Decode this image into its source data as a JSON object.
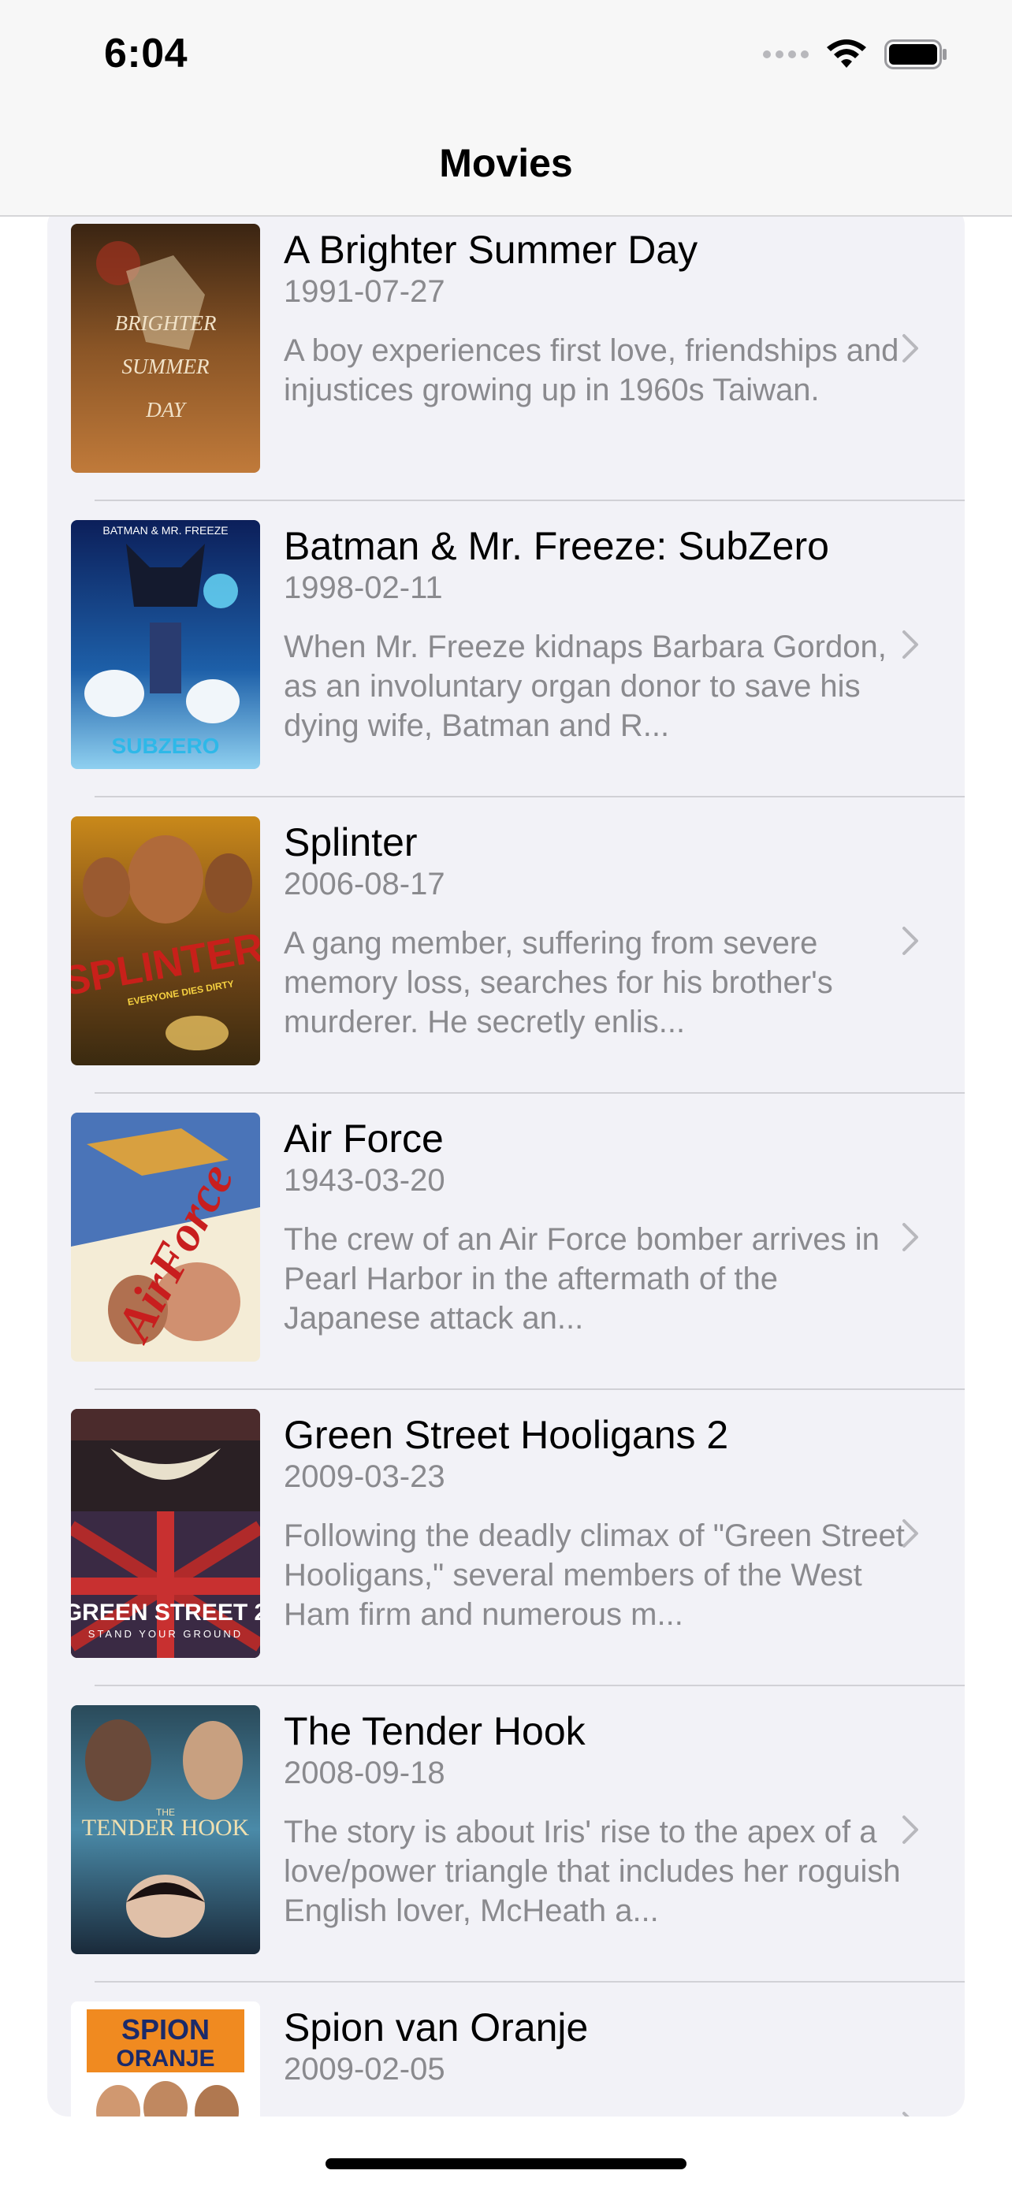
{
  "status_bar": {
    "time": "6:04",
    "icons": [
      "cellular-signal-icon",
      "wifi-icon",
      "battery-icon"
    ]
  },
  "nav": {
    "title": "Movies"
  },
  "movies": [
    {
      "title": "A Brighter Summer Day",
      "date": "1991-07-27",
      "description": "A boy experiences first love, friendships and injustices growing up in 1960s Taiwan.",
      "poster_text": [
        "BRIGHTER",
        "SUMMER",
        "DAY"
      ]
    },
    {
      "title": "Batman & Mr. Freeze: SubZero",
      "date": "1998-02-11",
      "description": "When Mr. Freeze kidnaps Barbara Gordon, as an involuntary organ donor to save his dying wife, Batman and R...",
      "poster_text": [
        "BATMAN & MR. FREEZE",
        "SUBZERO"
      ]
    },
    {
      "title": "Splinter",
      "date": "2006-08-17",
      "description": "A gang member, suffering from severe memory loss, searches for his brother's murderer. He secretly enlis...",
      "poster_text": [
        "SPLINTER",
        "EVERYONE DIES DIRTY"
      ]
    },
    {
      "title": "Air Force",
      "date": "1943-03-20",
      "description": "The crew of an Air Force bomber arrives in Pearl Harbor in the aftermath of the Japanese attack an...",
      "poster_text": [
        "AirForce"
      ]
    },
    {
      "title": "Green Street Hooligans 2",
      "date": "2009-03-23",
      "description": "Following the deadly climax of \"Green Street Hooligans,\" several members of the West Ham firm and numerous m...",
      "poster_text": [
        "GREEN STREET 2",
        "STAND YOUR GROUND"
      ]
    },
    {
      "title": "The Tender Hook",
      "date": "2008-09-18",
      "description": "The story is about Iris' rise to the apex of a love/power triangle that includes her roguish English lover, McHeath a...",
      "poster_text": [
        "THE",
        "TENDER HOOK"
      ]
    },
    {
      "title": "Spion van Oranje",
      "date": "2009-02-05",
      "description": "",
      "poster_text": [
        "SPION",
        "ORANJE"
      ]
    }
  ]
}
